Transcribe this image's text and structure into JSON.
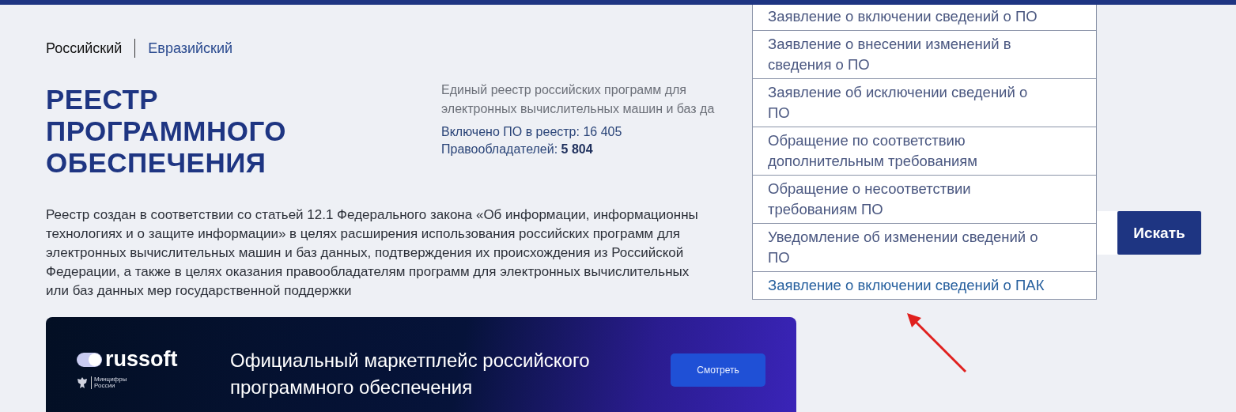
{
  "registry_tabs": [
    {
      "label": "Российский",
      "selected": true
    },
    {
      "label": "Евразийский",
      "selected": false
    }
  ],
  "title": "РЕЕСТР ПРОГРАММНОГО ОБЕСПЕЧЕНИЯ",
  "description": "Единый реестр российских программ для\nэлектронных вычислительных машин и баз да",
  "stats": [
    "Включено ПО в реестр: 16 405",
    "Правообладателей: **5 804**"
  ],
  "about": "Реестр создан в соответствии со статьей 12.1 Федерального закона «Об информации, информационны\nтехнологиях и о защите информации» в целях расширения использования российских программ для\nэлектронных вычислительных машин и баз данных, подтверждения их происхождения из Российской\nФедерации, а также в целях оказания правообладателям программ для электронных вычислительных\nили баз данных мер государственной поддержки",
  "search": {
    "button": "Искать"
  },
  "dropdown": {
    "items": [
      {
        "label": "Заявление о включении сведений о ПО",
        "selected": false
      },
      {
        "label": "Заявление о внесении изменений в сведения о ПО",
        "selected": false
      },
      {
        "label": "Заявление об исключении сведений о ПО",
        "selected": false
      },
      {
        "label": "Обращение по соответствию дополнительным требованиям",
        "selected": false
      },
      {
        "label": "Обращение о несоответствии требованиям ПО",
        "selected": false
      },
      {
        "label": "Уведомление об изменении сведений о ПО",
        "selected": false
      },
      {
        "label": "Заявление о включении сведений о ПАК",
        "selected": true
      }
    ]
  },
  "banner": {
    "logo": "russoft",
    "ministry": "Минцифры\nРоссии",
    "headline": "Официальный маркетплейс российского\nпрограммного обеспечения",
    "button": "Смотреть"
  }
}
